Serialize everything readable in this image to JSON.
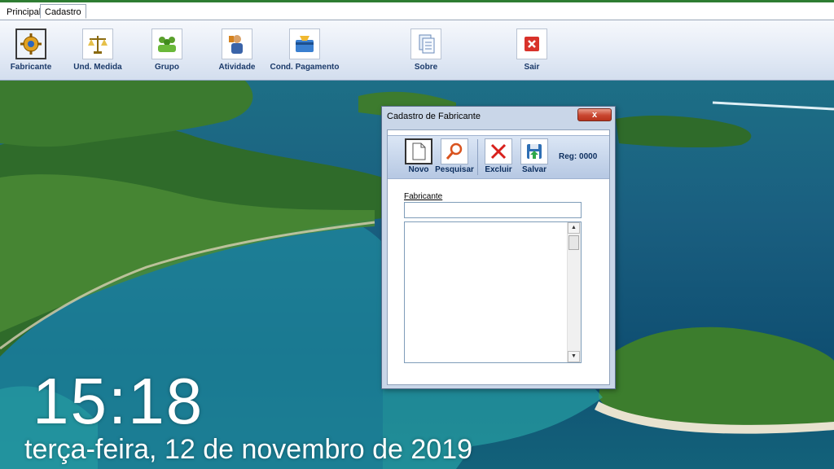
{
  "tabs": [
    {
      "label": "Principal",
      "active": false
    },
    {
      "label": "Cadastro",
      "active": true
    }
  ],
  "toolbar": {
    "buttons": [
      {
        "label": "Fabricante",
        "icon": "gear-icon",
        "selected": true
      },
      {
        "label": "Und. Medida",
        "icon": "scale-icon"
      },
      {
        "label": "Grupo",
        "icon": "group-icon"
      },
      {
        "label": "Atividade",
        "icon": "worker-icon"
      },
      {
        "label": "Cond. Pagamento",
        "icon": "card-icon"
      },
      {
        "label": "Sobre",
        "icon": "documents-icon"
      },
      {
        "label": "Sair",
        "icon": "exit-icon"
      }
    ]
  },
  "dialog": {
    "title": "Cadastro de Fabricante",
    "close_label": "x",
    "buttons": [
      {
        "label": "Novo",
        "icon": "new-document-icon"
      },
      {
        "label": "Pesquisar",
        "icon": "magnifier-icon"
      },
      {
        "label": "Excluir",
        "icon": "delete-x-icon"
      },
      {
        "label": "Salvar",
        "icon": "floppy-save-icon"
      }
    ],
    "reg_label": "Reg:",
    "reg_value": "0000",
    "field_label": "Fabricante",
    "field_value": "",
    "list_items": []
  },
  "desktop": {
    "time": "15:18",
    "date": "terça-feira, 12 de novembro de 2019"
  },
  "colors": {
    "accent": "#1b3a6a",
    "close_red": "#c9452f",
    "sea": "#1a5f80"
  }
}
